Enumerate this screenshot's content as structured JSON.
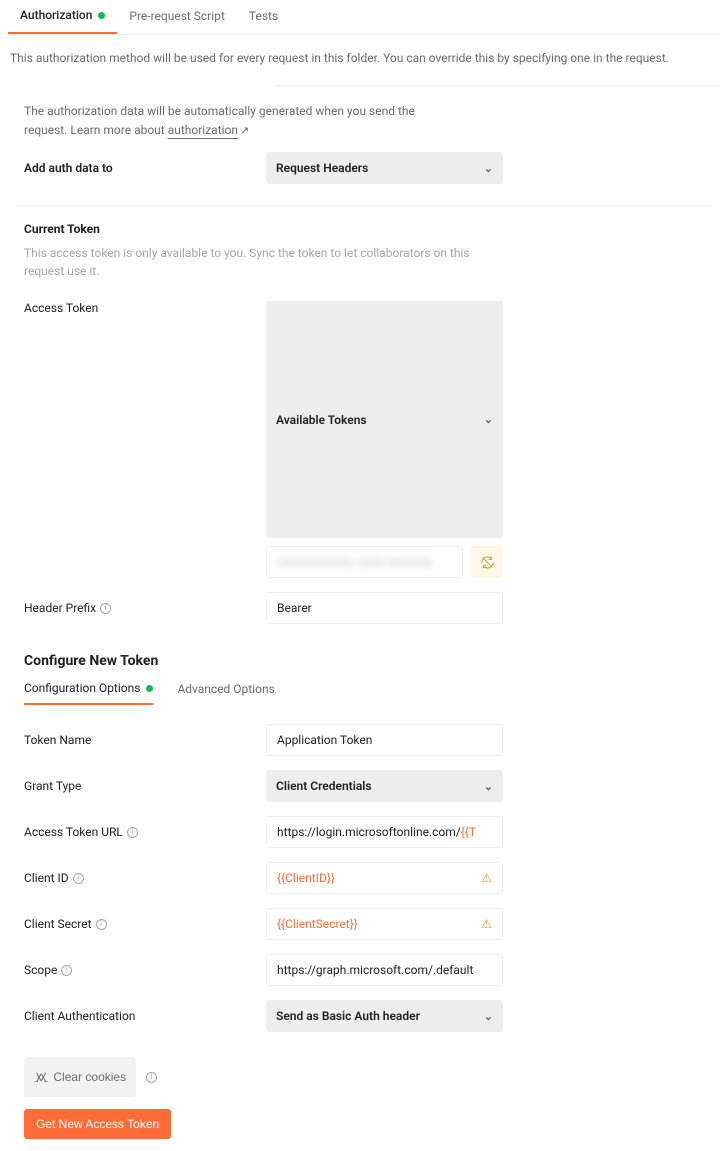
{
  "tabs": {
    "authorization": "Authorization",
    "prerequest": "Pre-request Script",
    "tests": "Tests"
  },
  "desc": "This authorization method will be used for every request in this folder. You can override this by specifying one in the request.",
  "note_pre": "The authorization data will be automatically generated when you send the request. Learn more about ",
  "note_link": "authorization",
  "add_auth": {
    "label": "Add auth data to",
    "value": "Request Headers"
  },
  "current_token": {
    "title": "Current Token",
    "desc": "This access token is only available to you. Sync the token to let collaborators on this request use it.",
    "access_token_label": "Access Token",
    "access_token_dd": "Available Tokens",
    "token_value": "xxxxxxxxxxxx xxxx xxxxxxx",
    "header_prefix_label": "Header Prefix",
    "header_prefix_value": "Bearer"
  },
  "configure": {
    "title": "Configure New Token",
    "tab_config": "Configuration Options",
    "tab_advanced": "Advanced Options",
    "token_name_label": "Token Name",
    "token_name_value": "Application Token",
    "grant_type_label": "Grant Type",
    "grant_type_value": "Client Credentials",
    "atu_label": "Access Token URL",
    "atu_value_pre": "https://login.microsoftonline.com/",
    "atu_value_var": "{{T",
    "client_id_label": "Client ID",
    "client_id_value": "{{ClientID}}",
    "client_secret_label": "Client Secret",
    "client_secret_value": "{{ClientSecret}}",
    "scope_label": "Scope",
    "scope_value": "https://graph.microsoft.com/.default ",
    "client_auth_label": "Client Authentication",
    "client_auth_value": "Send as Basic Auth header"
  },
  "buttons": {
    "clear_cookies": "Clear cookies",
    "get_token": "Get New Access Token"
  }
}
